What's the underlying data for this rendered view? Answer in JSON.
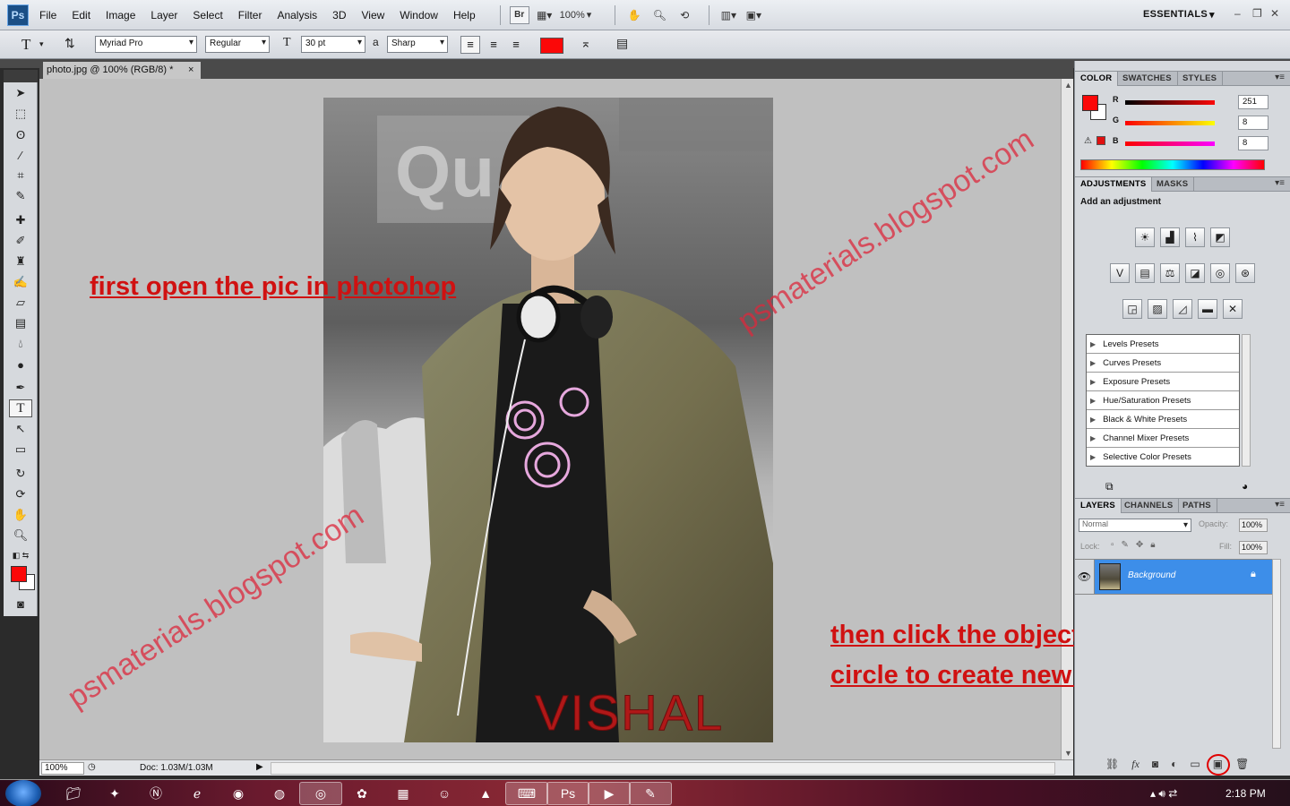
{
  "app": {
    "logo": "Ps"
  },
  "menu": [
    "File",
    "Edit",
    "Image",
    "Layer",
    "Select",
    "Filter",
    "Analysis",
    "3D",
    "View",
    "Window",
    "Help"
  ],
  "menubar_tools": {
    "bridge": "Br",
    "zoom": "100%",
    "workspace": "ESSENTIALS"
  },
  "options": {
    "tool_icon": "T",
    "font_family": "Myriad Pro",
    "font_style": "Regular",
    "font_size": "30 pt",
    "aa_icon": "a",
    "antialias": "Sharp",
    "text_color": "#fb0808"
  },
  "document": {
    "tab_title": "photo.jpg @ 100% (RGB/8) *",
    "close": "×",
    "status_zoom": "100%",
    "status_doc": "Doc: 1.03M/1.03M",
    "photo_caption": "VISHAL"
  },
  "annotations": {
    "step1": "first open the pic in photohop",
    "step2_line1": "then click the object in the",
    "step2_line2": "circle to create new layer.",
    "watermark": "psmaterials.blogspot.com"
  },
  "toolbox": {
    "tools": [
      "move-tool",
      "marquee-tool",
      "lasso-tool",
      "magic-wand-tool",
      "crop-tool",
      "eyedropper-tool",
      "healing-brush-tool",
      "brush-tool",
      "clone-stamp-tool",
      "history-brush-tool",
      "eraser-tool",
      "gradient-tool",
      "blur-tool",
      "dodge-tool",
      "pen-tool",
      "type-tool",
      "path-selection-tool",
      "shape-tool",
      "3d-rotate-tool",
      "3d-orbit-tool",
      "hand-tool",
      "zoom-tool"
    ],
    "selected": "type-tool",
    "foreground_color": "#fb0808",
    "background_color": "#ffffff"
  },
  "color_panel": {
    "tabs": [
      "COLOR",
      "SWATCHES",
      "STYLES"
    ],
    "active_tab": "COLOR",
    "channels": [
      {
        "label": "R",
        "value": "251"
      },
      {
        "label": "G",
        "value": "8"
      },
      {
        "label": "B",
        "value": "8"
      }
    ]
  },
  "adjustments_panel": {
    "tabs": [
      "ADJUSTMENTS",
      "MASKS"
    ],
    "active_tab": "ADJUSTMENTS",
    "heading": "Add an adjustment",
    "presets": [
      "Levels Presets",
      "Curves Presets",
      "Exposure Presets",
      "Hue/Saturation Presets",
      "Black & White Presets",
      "Channel Mixer Presets",
      "Selective Color Presets"
    ]
  },
  "layers_panel": {
    "tabs": [
      "LAYERS",
      "CHANNELS",
      "PATHS"
    ],
    "active_tab": "LAYERS",
    "blend_mode": "Normal",
    "opacity_label": "Opacity:",
    "opacity": "100%",
    "lock_label": "Lock:",
    "fill_label": "Fill:",
    "fill": "100%",
    "layers": [
      {
        "name": "Background",
        "locked": true,
        "visible": true
      }
    ]
  },
  "taskbar": {
    "clock": "2:18 PM"
  }
}
